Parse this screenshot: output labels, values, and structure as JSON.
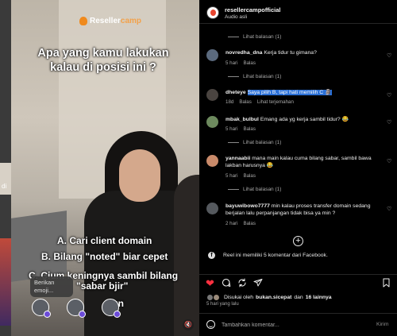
{
  "video": {
    "logo": {
      "brand_a": "Reseller",
      "brand_b": "camp"
    },
    "headline": "Apa yang kamu lakukan kalau di posisi ini ?",
    "options": {
      "a": "A. Cari client domain",
      "b": "B. Bilang \"noted\" biar cepet",
      "c1": "C. Cium keningnya sambil bilang",
      "c2": "\"sabar bjir\"",
      "sign": "ign"
    },
    "side_text": "di",
    "emoji_tooltip": "Berikan emoji...",
    "mute_icon": "speaker-muted-icon"
  },
  "header": {
    "account": "resellercampofficial",
    "audio": "Audio asli"
  },
  "view_replies_label": "Lihat balasan (1)",
  "comments": [
    {
      "user": "novredha_dna",
      "text": "Kerja tidur tu gimana?",
      "age": "5 hari",
      "reply": "Balas",
      "translate": "",
      "avatar_color": "#5b6a7e"
    },
    {
      "user": "dheteye",
      "text": "Saya pilih B, tapi hati memilih C 🗿",
      "age": "18d",
      "reply": "Balas",
      "translate": "Lihat terjemahan",
      "avatar_color": "#4a4440"
    },
    {
      "user": "mbak_bulbul",
      "text": "Emang ada yg kerja sambil tidur? 😂",
      "age": "5 hari",
      "reply": "Balas",
      "translate": "",
      "avatar_color": "#6d8a5e"
    },
    {
      "user": "yannaabii",
      "text": "mana main kalau cuma bilang sabar, sambil bawa lakban harusnya 😂",
      "age": "5 hari",
      "reply": "Balas",
      "translate": "",
      "avatar_color": "#c98a6a"
    },
    {
      "user": "bayuwibowo7777",
      "text": "min kalau proses transfer domain sedang berjalan lalu perpanjangan tidak bisa ya min ?",
      "age": "2 hari",
      "reply": "Balas",
      "translate": "",
      "avatar_color": "#55595e"
    }
  ],
  "load_more_icon": "plus-circle-icon",
  "facebook_note": "Reel ini memiliki 5 komentar dari Facebook.",
  "actions": {
    "like_icon": "heart-filled-icon",
    "comment_icon": "comment-icon",
    "share_icon": "repost-icon",
    "send_icon": "send-icon",
    "save_icon": "bookmark-icon",
    "like_color": "#ff3040"
  },
  "likes": {
    "prefix": "Disukai oleh",
    "user": "bukan.sicepat",
    "connector": "dan",
    "others": "16 lainnya",
    "time": "5 hari yang lalu"
  },
  "composer": {
    "placeholder": "Tambahkan komentar...",
    "post_label": "Kirim"
  }
}
